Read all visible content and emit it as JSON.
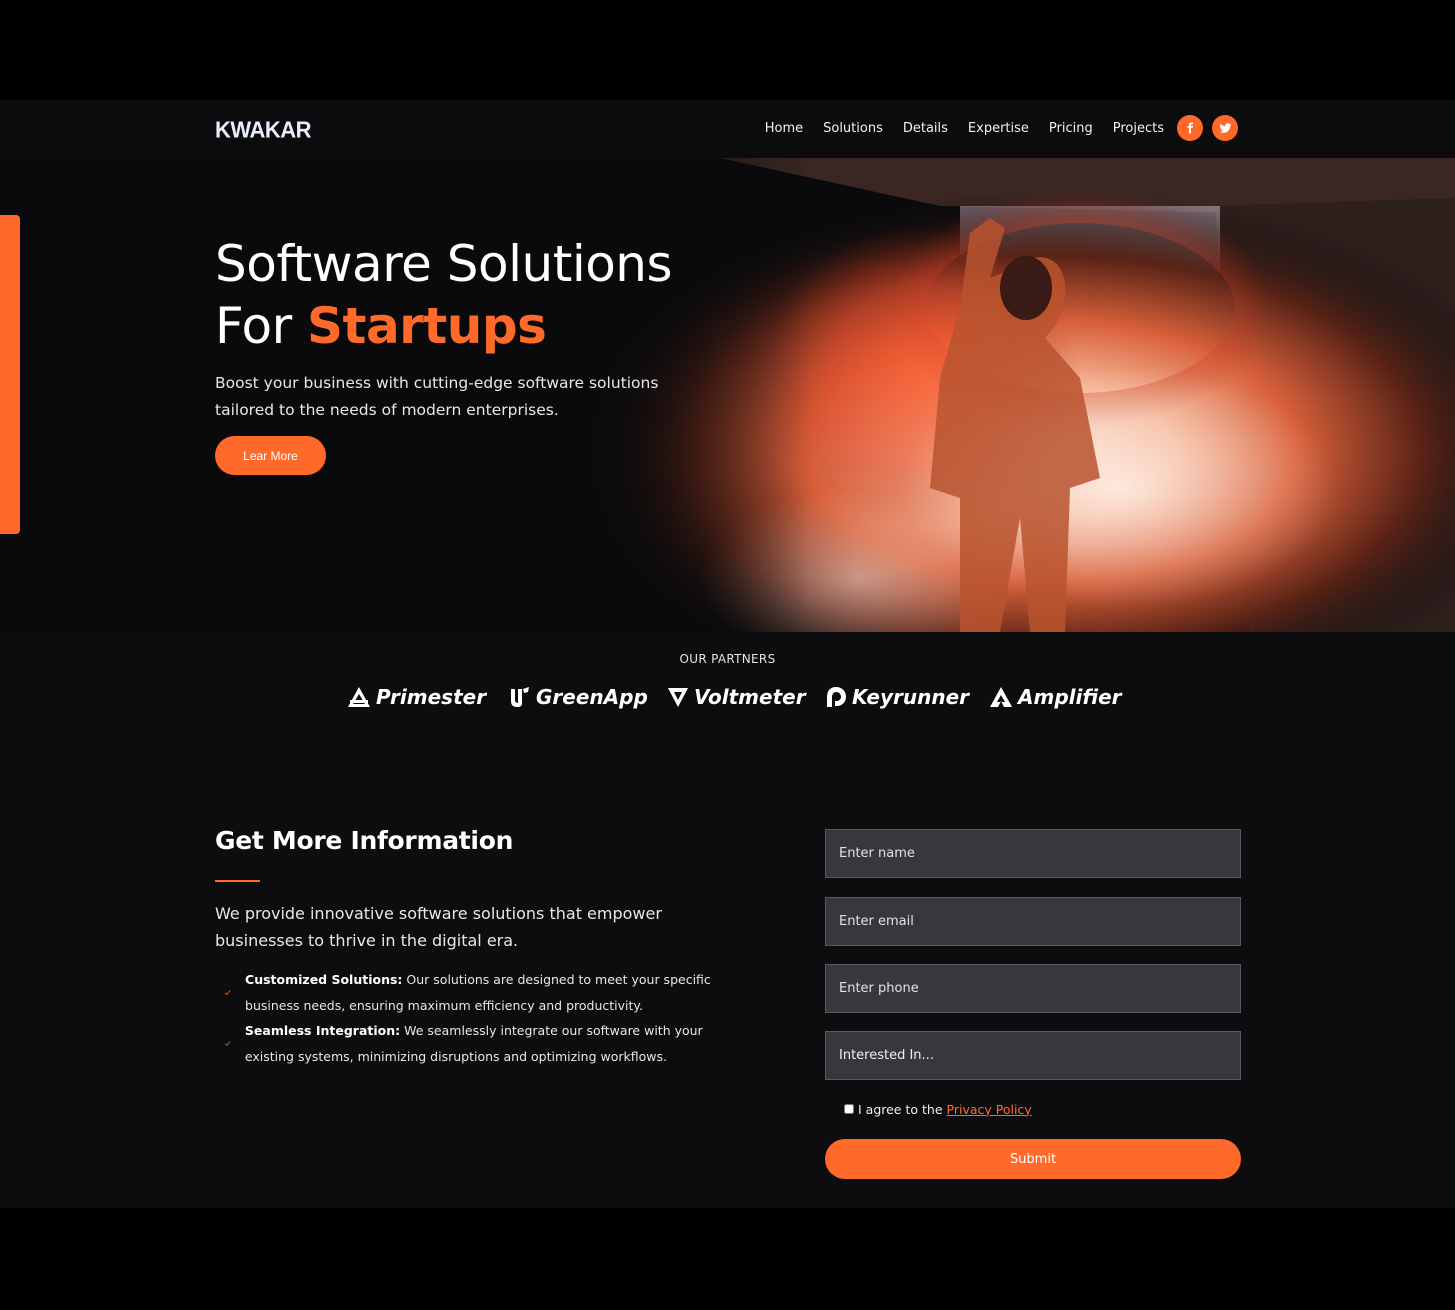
{
  "brand": {
    "logo": "KWAKAR",
    "accent_color": "#ff6a2a"
  },
  "nav": {
    "links": [
      "Home",
      "Solutions",
      "Details",
      "Expertise",
      "Pricing",
      "Projects"
    ],
    "social": [
      {
        "icon": "facebook-icon"
      },
      {
        "icon": "twitter-icon"
      }
    ]
  },
  "hero": {
    "title_line1": "Software Solutions",
    "title_line2_prefix": "For ",
    "title_highlight": "Startups",
    "subtitle": "Boost your business with cutting-edge software solutions tailored to the needs of modern enterprises.",
    "cta_label": "Lear More"
  },
  "partners": {
    "label": "OUR PARTNERS",
    "items": [
      {
        "name": "Primester",
        "icon": "primester-logo-icon"
      },
      {
        "name": "GreenApp",
        "icon": "greenapp-logo-icon"
      },
      {
        "name": "Voltmeter",
        "icon": "voltmeter-logo-icon"
      },
      {
        "name": "Keyrunner",
        "icon": "keyrunner-logo-icon"
      },
      {
        "name": "Amplifier",
        "icon": "amplifier-logo-icon"
      }
    ]
  },
  "info": {
    "title": "Get More Information",
    "text": "We provide innovative software solutions that empower businesses to thrive in the digital era.",
    "features": [
      {
        "title": "Customized Solutions:",
        "body": " Our solutions are designed to meet your specific business needs, ensuring maximum efficiency and productivity.",
        "icon": "check-icon"
      },
      {
        "title": "Seamless Integration:",
        "body": " We seamlessly integrate our software with your existing systems, minimizing disruptions and optimizing workflows.",
        "icon": "check-icon"
      }
    ]
  },
  "form": {
    "name_placeholder": "Enter name",
    "email_placeholder": "Enter email",
    "phone_placeholder": "Enter phone",
    "interest_value": "Interested In...",
    "agree_prefix": "I agree to the ",
    "privacy_link": "Privacy Policy",
    "submit_label": "Submit"
  }
}
